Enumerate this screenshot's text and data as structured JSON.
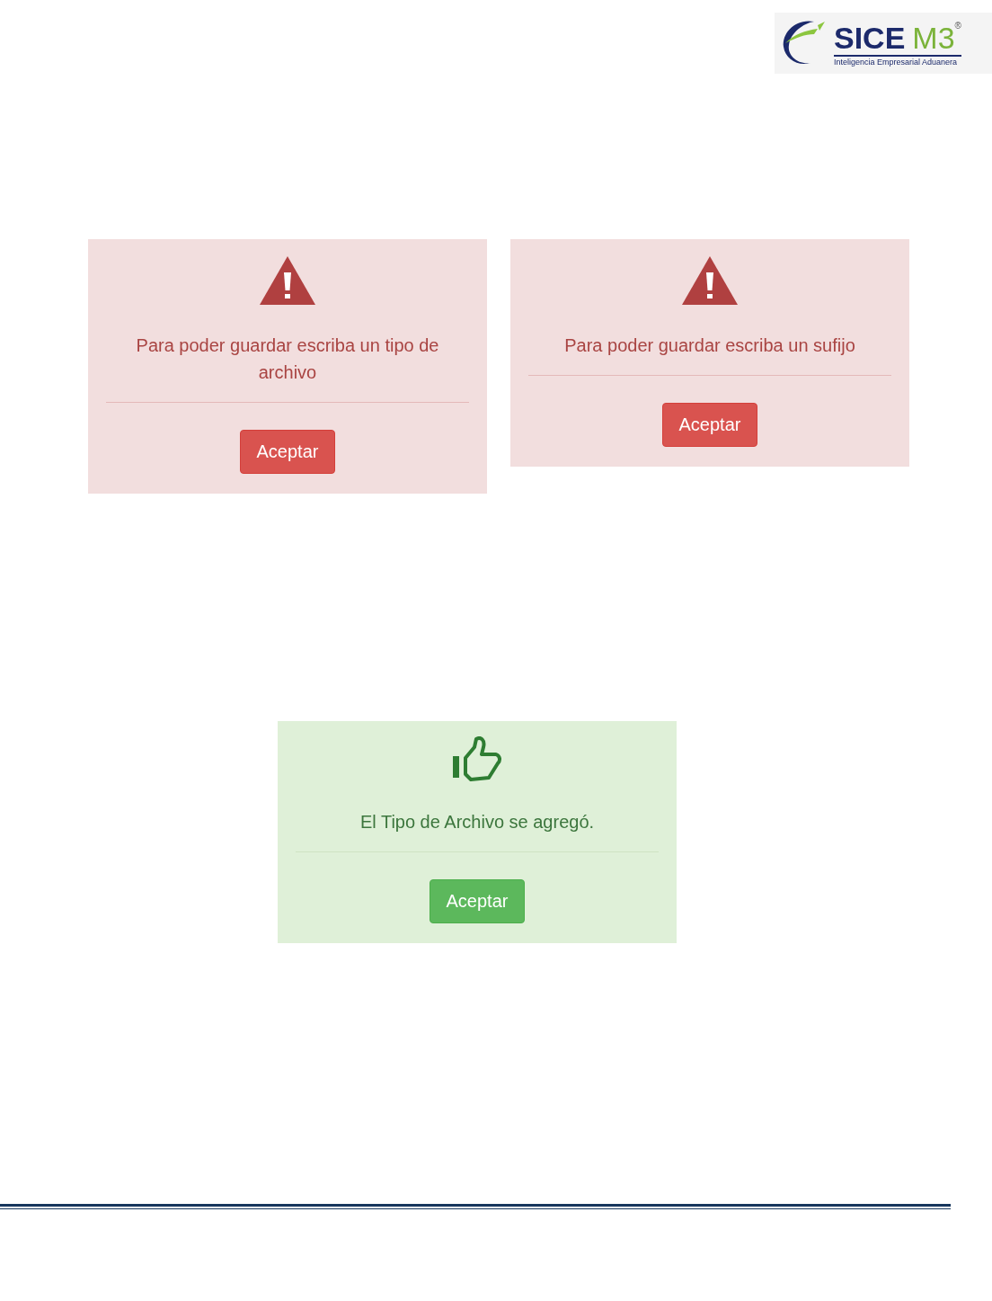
{
  "logo": {
    "brand": "SICE",
    "suffix": "M3",
    "registered": "®",
    "tagline": "Inteligencia Empresarial Aduanera"
  },
  "dialog_rows": [
    {
      "dialogs": [
        {
          "kind": "error",
          "message": "Para poder guardar escriba un tipo de archivo",
          "button": "Aceptar"
        },
        {
          "kind": "error",
          "message": "Para poder guardar escriba un sufijo",
          "button": "Aceptar"
        }
      ]
    },
    {
      "dialogs": [
        {
          "kind": "success",
          "message": "El Tipo de Archivo se agregó.",
          "button": "Aceptar"
        }
      ]
    }
  ]
}
